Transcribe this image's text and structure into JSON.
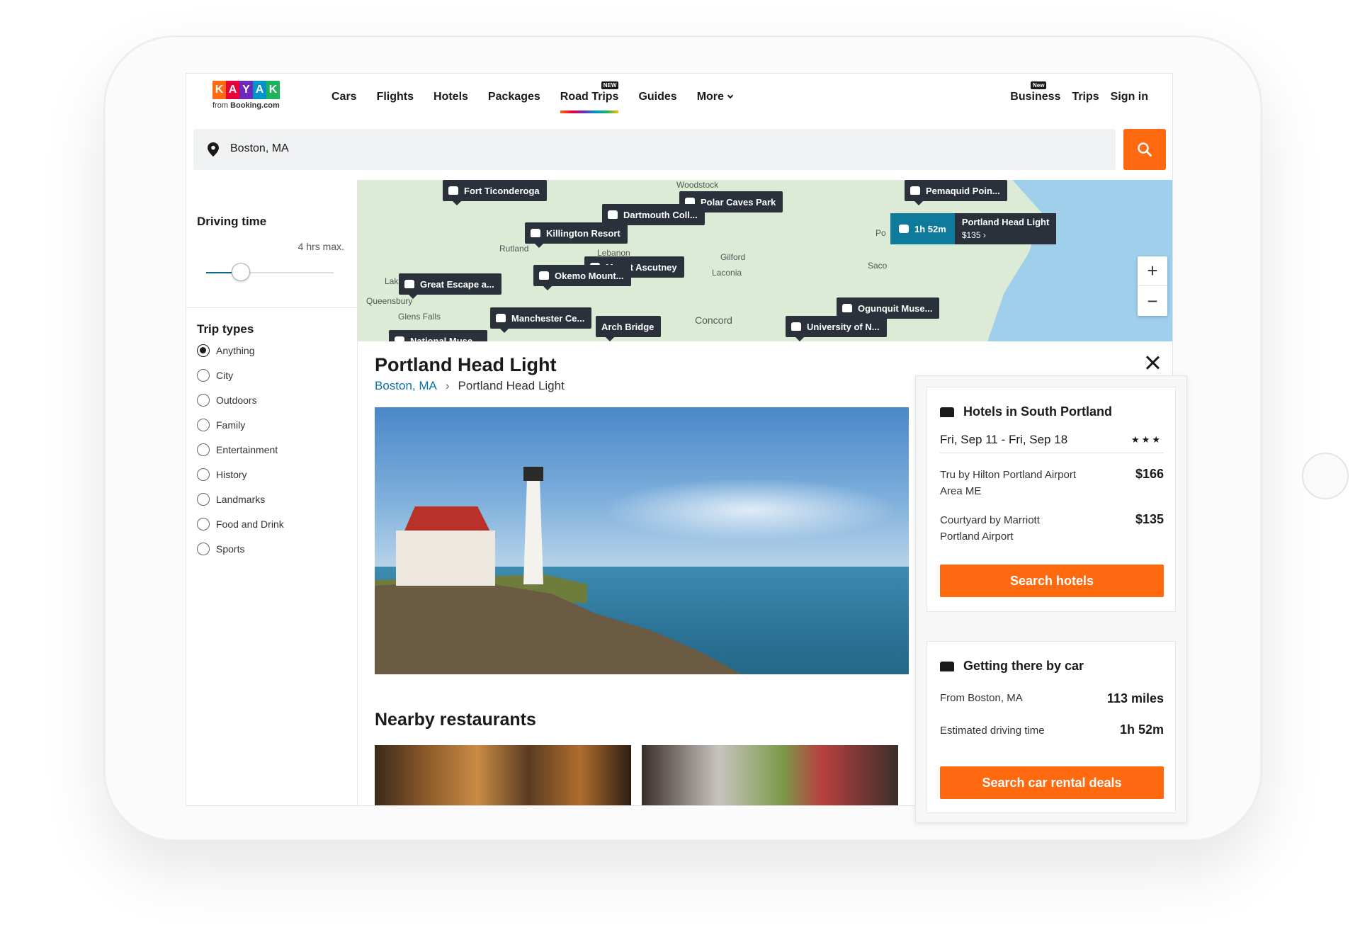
{
  "header": {
    "logo_letters": [
      "K",
      "A",
      "Y",
      "A",
      "K"
    ],
    "logo_colors": [
      "#ff690f",
      "#e9003a",
      "#6c2ab8",
      "#0093c9",
      "#1eb25d"
    ],
    "logo_sub_prefix": "from",
    "logo_sub_brand": "Booking.com",
    "nav": [
      "Cars",
      "Flights",
      "Hotels",
      "Packages",
      "Road Trips",
      "Guides",
      "More"
    ],
    "new_badge": "NEW",
    "business_badge": "New",
    "right_nav": [
      "Business",
      "Trips",
      "Sign in"
    ]
  },
  "search": {
    "value": "Boston, MA"
  },
  "sidebar": {
    "driving_title": "Driving time",
    "driving_max": "4 hrs max.",
    "driving_level": 0.27,
    "trip_types_title": "Trip types",
    "trip_types": [
      "Anything",
      "City",
      "Outdoors",
      "Family",
      "Entertainment",
      "History",
      "Landmarks",
      "Food and Drink",
      "Sports"
    ],
    "selected": "Anything"
  },
  "map": {
    "towns": [
      "Woodstock",
      "Rutland",
      "Lebanon",
      "Gilford",
      "Laconia",
      "Saco",
      "Queensbury",
      "Glens Falls",
      "Concord",
      "Lak",
      "Po"
    ],
    "labels": [
      "Fort Ticonderoga",
      "Polar Caves Park",
      "Dartmouth Coll...",
      "Killington Resort",
      "Mount Ascutney",
      "Great Escape a...",
      "Okemo Mount...",
      "Manchester Ce...",
      "Arch Bridge",
      "National Muse...",
      "Ogunquit Muse...",
      "University of N...",
      "Pemaquid Poin..."
    ],
    "active": {
      "time": "1h 52m",
      "name": "Portland Head Light",
      "price": "$135 ›"
    },
    "zoom_in": "+",
    "zoom_out": "−"
  },
  "detail": {
    "title": "Portland Head Light",
    "crumb_link": "Boston, MA",
    "crumb_sep": "›",
    "crumb_current": "Portland Head Light",
    "nearby_title": "Nearby restaurants"
  },
  "hotels": {
    "title": "Hotels in South Portland",
    "dates": "Fri, Sep 11 - Fri, Sep 18",
    "stars": "★★★",
    "items": [
      {
        "name": "Tru by Hilton Portland Airport Area ME",
        "price": "$166"
      },
      {
        "name": "Courtyard by Marriott Portland Airport",
        "price": "$135"
      }
    ],
    "button": "Search hotels"
  },
  "car": {
    "title": "Getting there by car",
    "rows": [
      {
        "label": "From Boston, MA",
        "value": "113 miles"
      },
      {
        "label": "Estimated driving time",
        "value": "1h 52m"
      }
    ],
    "button": "Search car rental deals"
  }
}
